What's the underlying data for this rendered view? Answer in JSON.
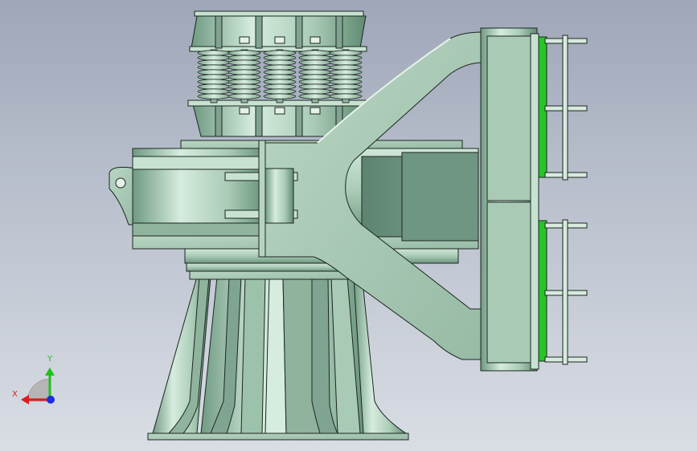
{
  "viewport": {
    "background_top": "#9ea6b8",
    "background_bottom": "#d9dde4"
  },
  "model": {
    "body_color": "#a9cbb6",
    "edge_color": "#1c2620",
    "pad_color": "#27c427",
    "spring_color": "#9fc4ae"
  },
  "triad": {
    "x_label": "X",
    "y_label": "Y",
    "x_color": "#e01b1b",
    "y_color": "#1bc21b",
    "z_color": "#1b2ee0"
  }
}
